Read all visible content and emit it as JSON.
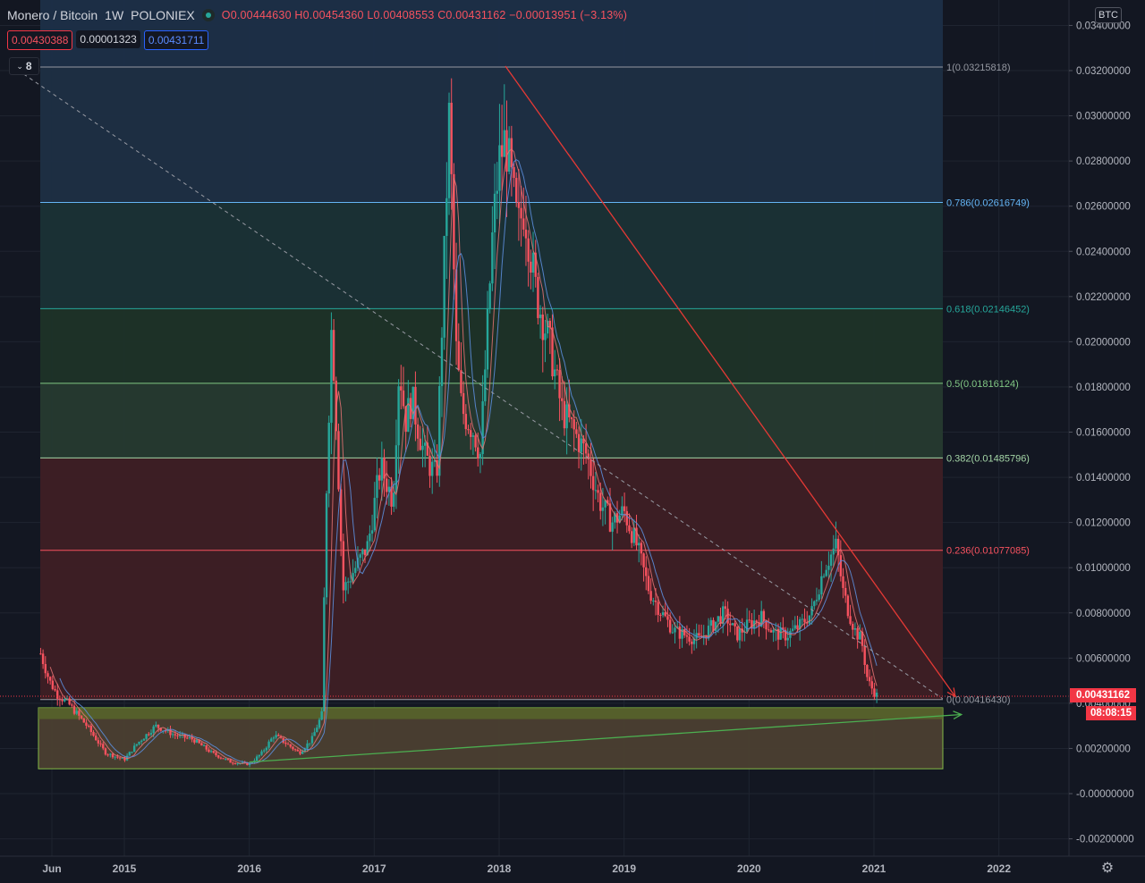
{
  "header": {
    "symbol": "Monero / Bitcoin",
    "interval": "1W",
    "exchange": "POLONIEX",
    "ohlc": "O0.00444630 H0.00454360 L0.00408553 C0.00431162 −0.00013951 (−3.13%)"
  },
  "quote": {
    "bid": "0.00430388",
    "spread": "0.00001323",
    "ask": "0.00431711"
  },
  "indicators_collapsed_count": "8",
  "axis_currency": "BTC",
  "last_price_label": "0.00431162",
  "countdown_label": "08:08:15",
  "icons": {
    "settings": "gear-icon",
    "status": "market-status-dot-icon",
    "collapse": "chevron-down-icon"
  },
  "colors": {
    "background": "#131722",
    "up": "#26a69a",
    "down": "#f7525f",
    "trend_red": "#e53935",
    "trend_green": "#4caf50",
    "ma_blue": "#5b8cd8",
    "ma_red": "#e57373"
  },
  "chart_data": {
    "type": "candlestick",
    "title": "Monero / Bitcoin · 1W · POLONIEX",
    "ylim": [
      -0.003,
      0.0345
    ],
    "y_ticks": [
      "0.03400000",
      "0.03200000",
      "0.03000000",
      "0.02800000",
      "0.02600000",
      "0.02400000",
      "0.02200000",
      "0.02000000",
      "0.01800000",
      "0.01600000",
      "0.01400000",
      "0.01200000",
      "0.01000000",
      "0.00800000",
      "0.00600000",
      "0.00400000",
      "0.00200000",
      "-0.00000000",
      "-0.00200000"
    ],
    "y_tick_values": [
      0.034,
      0.032,
      0.03,
      0.028,
      0.026,
      0.024,
      0.022,
      0.02,
      0.018,
      0.016,
      0.014,
      0.012,
      0.01,
      0.008,
      0.006,
      0.004,
      0.002,
      0.0,
      -0.002
    ],
    "x_ticks": [
      "Jun",
      "2015",
      "2016",
      "2017",
      "2018",
      "2019",
      "2020",
      "2021",
      "2022"
    ],
    "x_tick_values": [
      2014.42,
      2015.0,
      2016.0,
      2017.0,
      2018.0,
      2019.0,
      2020.0,
      2021.0,
      2022.0
    ],
    "xlim": [
      2014.1,
      2022.5
    ],
    "fib_levels": [
      {
        "ratio": 1,
        "price": 0.03215818,
        "label": "1(0.03215818)",
        "color": "#9598a1",
        "fill": "#2a2e39"
      },
      {
        "ratio": 0.786,
        "price": 0.02616749,
        "label": "0.786(0.02616749)",
        "color": "#64b5f6",
        "fill": "#1e2f45"
      },
      {
        "ratio": 0.618,
        "price": 0.02146452,
        "label": "0.618(0.02146452)",
        "color": "#26a69a",
        "fill": "#1a3236"
      },
      {
        "ratio": 0.5,
        "price": 0.01816124,
        "label": "0.5(0.01816124)",
        "color": "#81c784",
        "fill": "#1e3328"
      },
      {
        "ratio": 0.382,
        "price": 0.01485796,
        "label": "0.382(0.01485796)",
        "color": "#a5d6a7",
        "fill": "#263a30"
      },
      {
        "ratio": 0.236,
        "price": 0.01077085,
        "label": "0.236(0.01077085)",
        "color": "#f7525f",
        "fill": "#3e1f25"
      },
      {
        "ratio": 0,
        "price": 0.0041643,
        "label": "0(0.00416430)",
        "color": "#9598a1",
        "fill": "#3e1f25"
      }
    ],
    "fib_x_range": [
      2014.1,
      2021.55
    ],
    "top_fill_above_fib1": "#1c2f48",
    "support_zone": {
      "x": [
        2014.1,
        2021.55
      ],
      "y": [
        0.0011,
        0.0038
      ],
      "color": "#8bc34a"
    },
    "support_zone_upper": {
      "y": [
        0.0033,
        0.0038
      ]
    },
    "trendlines": [
      {
        "name": "downtrend",
        "x": [
          2018.05,
          2021.65
        ],
        "y": [
          0.0322,
          0.0043
        ],
        "color": "#e53935",
        "arrow": true
      },
      {
        "name": "uptrend",
        "x": [
          2016.0,
          2021.7
        ],
        "y": [
          0.0014,
          0.0035
        ],
        "color": "#4caf50",
        "arrow": true
      },
      {
        "name": "fib-diagonal",
        "x": [
          2014.1,
          2021.55
        ],
        "y": [
          0.0322,
          0.0042
        ],
        "color": "#9598a1",
        "dashed": true
      }
    ],
    "last_price": 0.00431162,
    "series": [
      {
        "name": "close",
        "x": [
          2014.33,
          2014.4,
          2014.46,
          2014.55,
          2014.7,
          2014.85,
          2015.0,
          2015.1,
          2015.25,
          2015.4,
          2015.55,
          2015.7,
          2015.85,
          2016.0,
          2016.1,
          2016.2,
          2016.3,
          2016.4,
          2016.5,
          2016.58,
          2016.62,
          2016.66,
          2016.7,
          2016.75,
          2016.85,
          2016.95,
          2017.05,
          2017.15,
          2017.2,
          2017.25,
          2017.3,
          2017.4,
          2017.5,
          2017.6,
          2017.63,
          2017.65,
          2017.7,
          2017.8,
          2017.85,
          2017.9,
          2017.95,
          2018.0,
          2018.05,
          2018.1,
          2018.15,
          2018.2,
          2018.25,
          2018.3,
          2018.4,
          2018.5,
          2018.6,
          2018.7,
          2018.8,
          2018.9,
          2019.0,
          2019.1,
          2019.2,
          2019.3,
          2019.4,
          2019.5,
          2019.6,
          2019.7,
          2019.8,
          2019.9,
          2020.0,
          2020.1,
          2020.2,
          2020.3,
          2020.4,
          2020.5,
          2020.6,
          2020.7,
          2020.75,
          2020.8,
          2020.85,
          2020.9,
          2020.95,
          2021.0,
          2021.03
        ],
        "y": [
          0.0062,
          0.005,
          0.0044,
          0.004,
          0.003,
          0.0018,
          0.0015,
          0.0022,
          0.003,
          0.0026,
          0.0024,
          0.0018,
          0.0014,
          0.0013,
          0.0018,
          0.0026,
          0.0022,
          0.0018,
          0.0024,
          0.0035,
          0.014,
          0.021,
          0.016,
          0.009,
          0.01,
          0.011,
          0.0145,
          0.013,
          0.019,
          0.0165,
          0.0175,
          0.015,
          0.014,
          0.03,
          0.025,
          0.02,
          0.017,
          0.016,
          0.015,
          0.02,
          0.025,
          0.028,
          0.029,
          0.027,
          0.025,
          0.026,
          0.024,
          0.022,
          0.02,
          0.017,
          0.016,
          0.015,
          0.013,
          0.012,
          0.0125,
          0.011,
          0.009,
          0.008,
          0.0072,
          0.007,
          0.0068,
          0.0074,
          0.008,
          0.007,
          0.0075,
          0.0078,
          0.0071,
          0.007,
          0.0074,
          0.008,
          0.01,
          0.011,
          0.009,
          0.008,
          0.0072,
          0.0068,
          0.005,
          0.0045,
          0.0043
        ]
      }
    ]
  }
}
